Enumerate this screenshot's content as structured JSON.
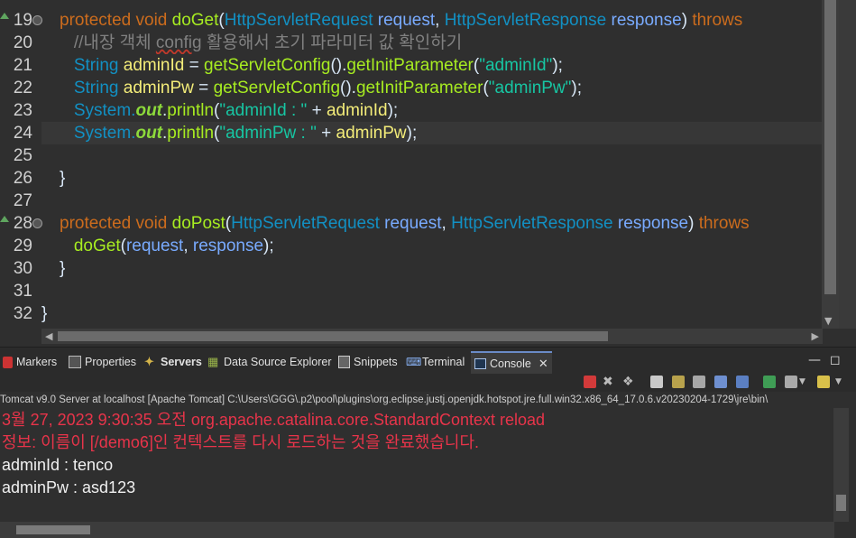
{
  "editor": {
    "lines": [
      {
        "num": "19",
        "fold": true,
        "override": true,
        "tokens": [
          {
            "t": "protected ",
            "c": "kw"
          },
          {
            "t": "void ",
            "c": "kw"
          },
          {
            "t": "doGet",
            "c": "me"
          },
          {
            "t": "(",
            "c": ""
          },
          {
            "t": "HttpServletRequest ",
            "c": "ty"
          },
          {
            "t": "request",
            "c": "pa"
          },
          {
            "t": ", ",
            "c": ""
          },
          {
            "t": "HttpServletResponse ",
            "c": "ty"
          },
          {
            "t": "response",
            "c": "pa"
          },
          {
            "t": ") ",
            "c": ""
          },
          {
            "t": "throws",
            "c": "kw"
          }
        ]
      },
      {
        "num": "20",
        "tokens": [
          {
            "t": "   //내장 객체 ",
            "c": "cm"
          },
          {
            "t": "config",
            "c": "cm wavy"
          },
          {
            "t": " 활용해서 초기 파라미터 값 확인하기",
            "c": "cm"
          }
        ]
      },
      {
        "num": "21",
        "tokens": [
          {
            "t": "   String ",
            "c": "ty"
          },
          {
            "t": "adminId",
            "c": "va"
          },
          {
            "t": " = ",
            "c": ""
          },
          {
            "t": "getServletConfig",
            "c": "me"
          },
          {
            "t": "().",
            "c": ""
          },
          {
            "t": "getInitParameter",
            "c": "me"
          },
          {
            "t": "(",
            "c": ""
          },
          {
            "t": "\"adminId\"",
            "c": "st"
          },
          {
            "t": ");",
            "c": ""
          }
        ]
      },
      {
        "num": "22",
        "tokens": [
          {
            "t": "   String ",
            "c": "ty"
          },
          {
            "t": "adminPw",
            "c": "va"
          },
          {
            "t": " = ",
            "c": ""
          },
          {
            "t": "getServletConfig",
            "c": "me"
          },
          {
            "t": "().",
            "c": ""
          },
          {
            "t": "getInitParameter",
            "c": "me"
          },
          {
            "t": "(",
            "c": ""
          },
          {
            "t": "\"adminPw\"",
            "c": "st"
          },
          {
            "t": ");",
            "c": ""
          }
        ]
      },
      {
        "num": "23",
        "tokens": [
          {
            "t": "   System.",
            "c": "ty"
          },
          {
            "t": "out",
            "c": "fi"
          },
          {
            "t": ".",
            "c": ""
          },
          {
            "t": "println",
            "c": "me"
          },
          {
            "t": "(",
            "c": ""
          },
          {
            "t": "\"adminId : \"",
            "c": "st"
          },
          {
            "t": " + ",
            "c": ""
          },
          {
            "t": "adminId",
            "c": "va"
          },
          {
            "t": ");",
            "c": ""
          }
        ]
      },
      {
        "num": "24",
        "current": true,
        "tokens": [
          {
            "t": "   System.",
            "c": "ty"
          },
          {
            "t": "out",
            "c": "fi"
          },
          {
            "t": ".",
            "c": ""
          },
          {
            "t": "println",
            "c": "me"
          },
          {
            "t": "(",
            "c": ""
          },
          {
            "t": "\"adminPw : \"",
            "c": "st"
          },
          {
            "t": " + ",
            "c": ""
          },
          {
            "t": "adminPw",
            "c": "va"
          },
          {
            "t": ");",
            "c": ""
          }
        ]
      },
      {
        "num": "25",
        "tokens": []
      },
      {
        "num": "26",
        "tokens": [
          {
            "t": "}",
            "c": ""
          }
        ]
      },
      {
        "num": "27",
        "tokens": []
      },
      {
        "num": "28",
        "fold": true,
        "override": true,
        "tokens": [
          {
            "t": "protected ",
            "c": "kw"
          },
          {
            "t": "void ",
            "c": "kw"
          },
          {
            "t": "doPost",
            "c": "me"
          },
          {
            "t": "(",
            "c": ""
          },
          {
            "t": "HttpServletRequest ",
            "c": "ty"
          },
          {
            "t": "request",
            "c": "pa"
          },
          {
            "t": ", ",
            "c": ""
          },
          {
            "t": "HttpServletResponse ",
            "c": "ty"
          },
          {
            "t": "response",
            "c": "pa"
          },
          {
            "t": ") ",
            "c": ""
          },
          {
            "t": "throws",
            "c": "kw"
          }
        ]
      },
      {
        "num": "29",
        "tokens": [
          {
            "t": "   doGet",
            "c": "me"
          },
          {
            "t": "(",
            "c": ""
          },
          {
            "t": "request",
            "c": "pa"
          },
          {
            "t": ", ",
            "c": ""
          },
          {
            "t": "response",
            "c": "pa"
          },
          {
            "t": ");",
            "c": ""
          }
        ]
      },
      {
        "num": "30",
        "tokens": [
          {
            "t": "}",
            "c": ""
          }
        ]
      },
      {
        "num": "31",
        "tokens": []
      },
      {
        "num": "32",
        "outdent": true,
        "tokens": [
          {
            "t": "}",
            "c": ""
          }
        ]
      }
    ]
  },
  "panel": {
    "tabs": {
      "markers": "Markers",
      "properties": "Properties",
      "servers": "Servers",
      "data_source_explorer": "Data Source Explorer",
      "snippets": "Snippets",
      "terminal": "Terminal",
      "console": "Console"
    },
    "console_header": "Tomcat v9.0 Server at localhost [Apache Tomcat] C:\\Users\\GGG\\.p2\\pool\\plugins\\org.eclipse.justj.openjdk.hotspot.jre.full.win32.x86_64_17.0.6.v20230204-1729\\jre\\bin\\",
    "console_lines": [
      {
        "text": "3월 27, 2023 9:30:35 오전 org.apache.catalina.core.StandardContext reload",
        "color": "#e8344a"
      },
      {
        "text": "정보: 이름이 [/demo6]인 컨텍스트를 다시 로드하는 것을 완료했습니다.",
        "color": "#e8344a"
      },
      {
        "text": "adminId : tenco",
        "color": "#f0f0f0"
      },
      {
        "text": "adminPw : asd123",
        "color": "#f0f0f0"
      }
    ]
  }
}
